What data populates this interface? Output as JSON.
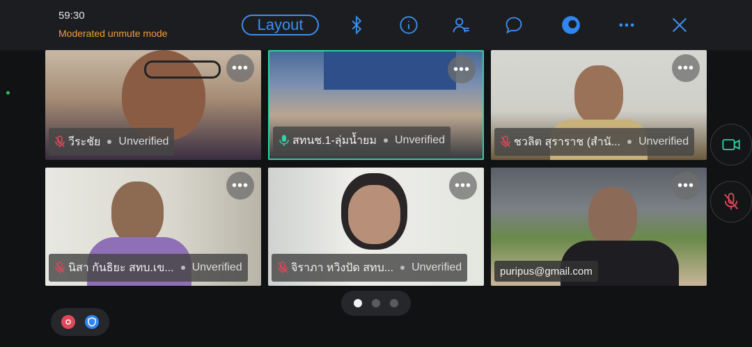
{
  "header": {
    "timer": "59:30",
    "mode": "Moderated unmute mode",
    "layout_label": "Layout",
    "icons": [
      "bluetooth-icon",
      "info-icon",
      "participants-icon",
      "chat-icon",
      "app-logo-icon",
      "more-icon",
      "close-icon"
    ]
  },
  "participants": [
    {
      "name": "วีระชัย",
      "status": "Unverified",
      "muted": true,
      "active": false
    },
    {
      "name": "สทนช.1-ลุ่มน้ำยม",
      "status": "Unverified",
      "muted": false,
      "active": true
    },
    {
      "name": "ชวลิต สุราราช (สำนั...",
      "status": "Unverified",
      "muted": true,
      "active": false
    },
    {
      "name": "นิสา  กันธิยะ สทบ.เข...",
      "status": "Unverified",
      "muted": true,
      "active": false
    },
    {
      "name": "จิราภา หวิงปัด สทบ...",
      "status": "Unverified",
      "muted": true,
      "active": false
    },
    {
      "email": "puripus@gmail.com"
    }
  ],
  "more_label": "•••",
  "colors": {
    "accent": "#3d8ff0",
    "warning": "#f0a03c",
    "active_border": "#2fd1a5",
    "muted_red": "#e0485a"
  },
  "pager": {
    "pages": 3,
    "current": 1
  }
}
